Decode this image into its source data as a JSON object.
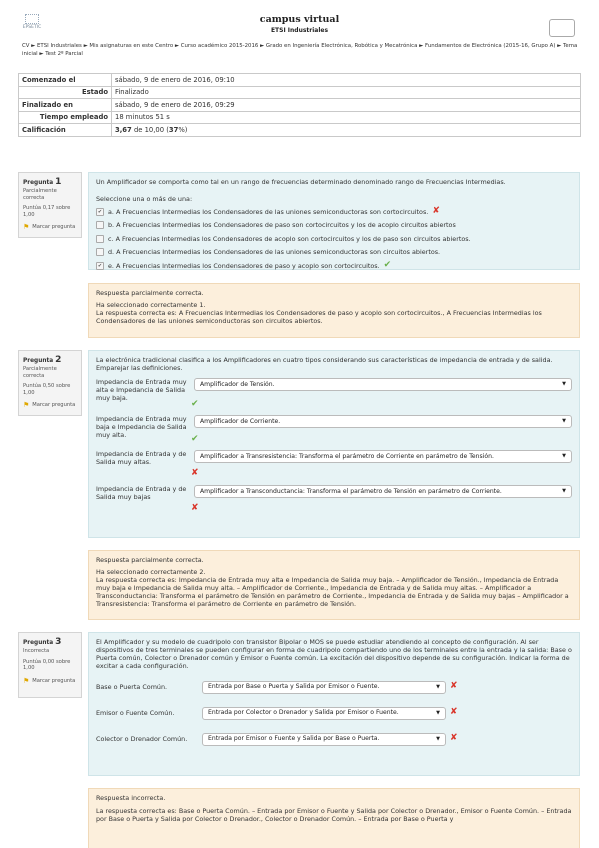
{
  "header": {
    "logo_text": "EPSETIC",
    "title": "campus virtual",
    "subtitle": "ETSI Industriales",
    "breadcrumb": "CV ► ETSI Industriales ► Mis asignaturas en este Centro ► Curso académico 2015-2016 ► Grado en Ingeniería Electrónica, Robótica y Mecatrónica ► Fundamentos de Electrónica (2015-16, Grupo A) ► Tema inicial ► Test 2º Parcial"
  },
  "summary": [
    {
      "key": "Comenzado el",
      "value": "sábado, 9 de enero de 2016, 09:10",
      "align": "left"
    },
    {
      "key": "Estado",
      "value": "Finalizado",
      "align": "right"
    },
    {
      "key": "Finalizado en",
      "value": "sábado, 9 de enero de 2016, 09:29",
      "align": "left"
    },
    {
      "key": "Tiempo empleado",
      "value": "18 minutos 51 s",
      "align": "right"
    },
    {
      "key": "Calificación",
      "value_bold": "3,67",
      "value_mid": " de 10,00 (",
      "value_pct": "37",
      "value_end": "%)",
      "align": "left"
    }
  ],
  "q1": {
    "label": "Pregunta",
    "num": "1",
    "status": "Parcialmente correcta",
    "score": "Puntúa 0,17 sobre 1,00",
    "flag": "Marcar pregunta",
    "text": "Un Amplificador se comporta como tal en un rango de frecuencias determinado denominado rango de Frecuencias Intermedias.",
    "prompt": "Seleccione una o más de una:",
    "options": [
      {
        "text": "a. A Frecuencias Intermedias los Condensadores de las uniones semiconductoras son cortocircuitos.",
        "checked": true,
        "mark": "bad"
      },
      {
        "text": "b. A Frecuencias Intermedias los Condensadores de paso son cortocircuitos y los de acoplo circuitos abiertos",
        "checked": false,
        "mark": ""
      },
      {
        "text": "c. A Frecuencias Intermedias los Condensadores de acoplo son cortocircuitos y los de paso son circuitos abiertos.",
        "checked": false,
        "mark": ""
      },
      {
        "text": "d. A Frecuencias Intermedias los Condensadores de las uniones semiconductoras son circuitos abiertos.",
        "checked": false,
        "mark": ""
      },
      {
        "text": "e. A Frecuencias Intermedias los Condensadores de paso y acoplo son cortocircuitos.",
        "checked": true,
        "mark": "ok"
      }
    ],
    "fb_title": "Respuesta parcialmente correcta.",
    "fb_line1": "Ha seleccionado correctamente 1.",
    "fb_line2": "La respuesta correcta es: A Frecuencias Intermedias los Condensadores de paso y acoplo son cortocircuitos., A Frecuencias Intermedias los Condensadores de las uniones semiconductoras son circuitos abiertos."
  },
  "q2": {
    "label": "Pregunta",
    "num": "2",
    "status": "Parcialmente correcta",
    "score": "Puntúa 0,50 sobre 1,00",
    "flag": "Marcar pregunta",
    "text": "La electrónica tradicional clasifica a los Amplificadores en cuatro tipos considerando sus características de impedancia de entrada y de salida. Emparejar las definiciones.",
    "rows": [
      {
        "label": "Impedancia de Entrada muy alta e Impedancia de Salida muy baja.",
        "value": "Amplificador de Tensión.",
        "mark": "ok"
      },
      {
        "label": "Impedancia de Entrada muy baja e Impedancia de Salida muy alta.",
        "value": "Amplificador de Corriente.",
        "mark": "ok"
      },
      {
        "label": "Impedancia de Entrada y de Salida muy altas.",
        "value": "Amplificador a Transresistencia: Transforma el parámetro de Corriente en parámetro de Tensión.",
        "mark": "bad"
      },
      {
        "label": "Impedancia de Entrada y de Salida muy bajas",
        "value": "Amplificador a Transconductancia: Transforma el parámetro de Tensión en parámetro de Corriente.",
        "mark": "bad"
      }
    ],
    "fb_title": "Respuesta parcialmente correcta.",
    "fb_line1": "Ha seleccionado correctamente 2.",
    "fb_line2": "La respuesta correcta es: Impedancia de Entrada muy alta e Impedancia de Salida muy baja. – Amplificador de Tensión., Impedancia de Entrada muy baja e Impedancia de Salida muy alta. – Amplificador de Corriente., Impedancia de Entrada y de Salida muy altas. – Amplificador a Transconductancia: Transforma el parámetro de Tensión en parámetro de Corriente., Impedancia de Entrada y de Salida muy bajas – Amplificador a Transresistencia: Transforma el parámetro de Corriente en parámetro de Tensión."
  },
  "q3": {
    "label": "Pregunta",
    "num": "3",
    "status": "Incorrecta",
    "score": "Puntúa 0,00 sobre 1,00",
    "flag": "Marcar pregunta",
    "text": "El Amplificador y su modelo de cuadripolo con transistor Bipolar o MOS se puede estudiar atendiendo al concepto de configuración. Al ser dispositivos de tres terminales se pueden configurar en forma de cuadripolo compartiendo uno de los terminales entre la entrada y la salida: Base o Puerta común, Colector o Drenador común y Emisor o Fuente común. La excitación del dispositivo depende de su configuración. Indicar la forma de excitar a cada configuración.",
    "rows": [
      {
        "label": "Base o Puerta Común.",
        "value": "Entrada por Base o Puerta y Salida por Emisor o Fuente.",
        "mark": "bad"
      },
      {
        "label": "Emisor o Fuente Común.",
        "value": "Entrada por Colector o Drenador y Salida por Emisor o Fuente.",
        "mark": "bad"
      },
      {
        "label": "Colector o Drenador Común.",
        "value": "Entrada por Emisor o Fuente y Salida por Base o Puerta.",
        "mark": "bad"
      }
    ],
    "fb_title": "Respuesta incorrecta.",
    "fb_line2": "La respuesta correcta es: Base o Puerta Común. – Entrada por Emisor o Fuente y Salida por Colector o Drenador., Emisor o Fuente Común. – Entrada por Base o Puerta y Salida por Colector o Drenador., Colector o Drenador Común. – Entrada por Base o Puerta y"
  },
  "colors": {
    "correct": "#6ab04c",
    "incorrect": "#d9352a",
    "question_bg": "#e7f3f5",
    "feedback_bg": "#fcefdc",
    "flag": "#e0a800"
  }
}
